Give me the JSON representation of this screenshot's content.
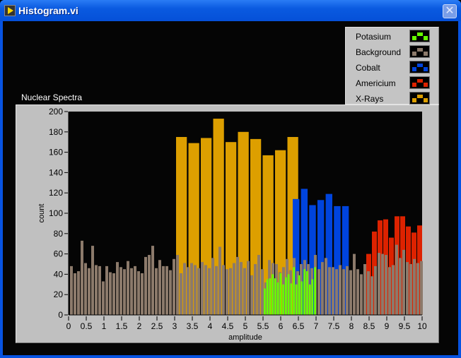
{
  "window": {
    "title": "Histogram.vi",
    "close_icon": "close-icon"
  },
  "legend": [
    {
      "name": "Potasium",
      "color": "#66ff00"
    },
    {
      "name": "Background",
      "color": "#8c7a6b"
    },
    {
      "name": "Cobalt",
      "color": "#0044dd"
    },
    {
      "name": "Americium",
      "color": "#dd2200"
    },
    {
      "name": "X-Rays",
      "color": "#dd9f00"
    }
  ],
  "chart_data": {
    "type": "bar",
    "title": "Nuclear Spectra",
    "xlabel": "amplitude",
    "ylabel": "count",
    "xlim": [
      0,
      10
    ],
    "ylim": [
      0,
      200
    ],
    "xticks": [
      "0",
      "0.5",
      "1",
      "1.5",
      "2",
      "2.5",
      "3",
      "3.5",
      "4",
      "4.5",
      "5",
      "5.5",
      "6",
      "6.5",
      "7",
      "7.5",
      "8",
      "8.5",
      "9",
      "9.5",
      "10"
    ],
    "yticks": [
      "0",
      "20",
      "40",
      "60",
      "80",
      "100",
      "120",
      "140",
      "160",
      "180",
      "200"
    ],
    "grid": false,
    "plot_background": "#050505",
    "series": [
      {
        "name": "X-Rays",
        "color": "#dd9f00",
        "x_start": 3.04,
        "bin_width": 0.35,
        "values": [
          175,
          169,
          174,
          193,
          170,
          180,
          173,
          157,
          162,
          175
        ]
      },
      {
        "name": "Cobalt",
        "color": "#0044dd",
        "x_start": 6.34,
        "bin_width": 0.233,
        "values": [
          114,
          124,
          108,
          113,
          119,
          107,
          107
        ]
      },
      {
        "name": "Americium",
        "color": "#dd2200",
        "x_start": 8.42,
        "bin_width": 0.16,
        "values": [
          60,
          82,
          93,
          94,
          76,
          97,
          97,
          87,
          81,
          88
        ]
      },
      {
        "name": "Background",
        "color": "#8c7a6b",
        "x_start": 0.04,
        "bin_width": 0.1,
        "values": [
          48,
          41,
          43,
          73,
          51,
          46,
          68,
          49,
          48,
          33,
          48,
          42,
          41,
          52,
          47,
          45,
          53,
          46,
          48,
          43,
          41,
          57,
          59,
          68,
          46,
          54,
          48,
          48,
          44,
          55,
          59,
          41,
          51,
          47,
          51,
          49,
          46,
          52,
          49,
          46,
          56,
          48,
          67,
          49,
          45,
          46,
          51,
          57,
          52,
          46,
          53,
          39,
          50,
          59,
          45,
          32,
          54,
          51,
          50,
          42,
          47,
          55,
          44,
          56,
          43,
          50,
          54,
          50,
          46,
          59,
          45,
          52,
          56,
          47,
          47,
          45,
          49,
          45,
          48,
          44,
          60,
          45,
          40,
          50,
          43,
          38,
          48,
          61,
          60,
          59,
          47,
          49,
          69,
          56,
          64,
          52,
          50,
          55,
          51,
          53
        ]
      },
      {
        "name": "Potasium",
        "color": "#66ff00",
        "x_start": 5.52,
        "bin_width": 0.075,
        "values": [
          26,
          35,
          36,
          40,
          36,
          32,
          41,
          30,
          37,
          40,
          31,
          47,
          30,
          39,
          33,
          45,
          43,
          30,
          35,
          47
        ]
      }
    ]
  }
}
